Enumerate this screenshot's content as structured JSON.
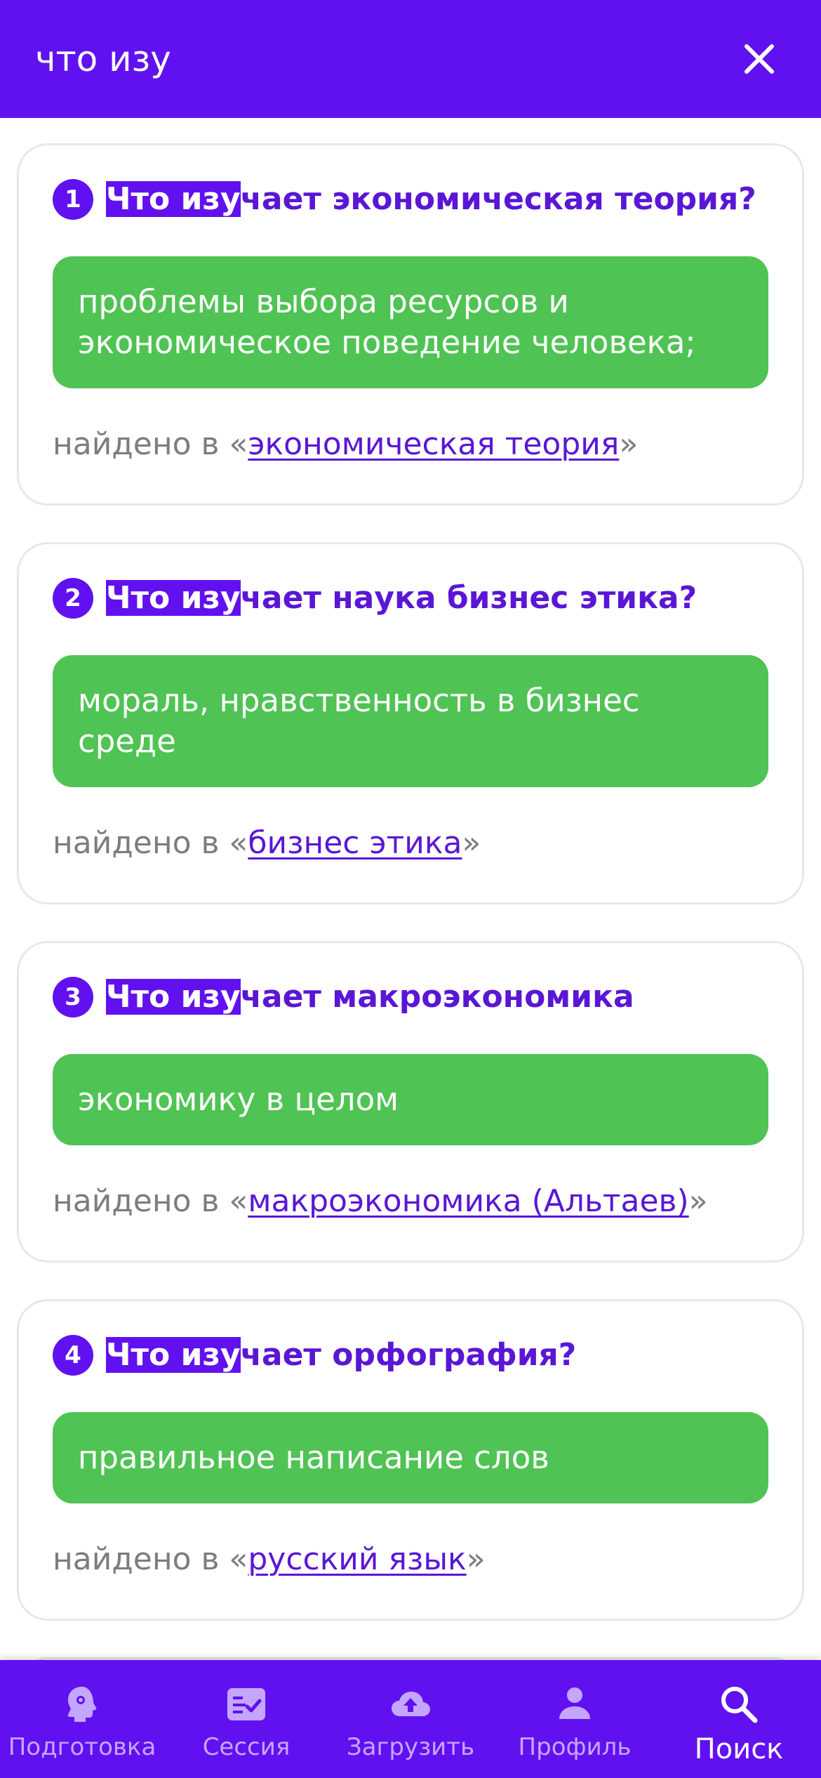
{
  "search": {
    "value": "что изу",
    "placeholder": ""
  },
  "results": [
    {
      "number": "1",
      "highlight": "Что изу",
      "rest": "чает экономическая теория?",
      "answer": "проблемы выбора ресурсов и экономическое поведение человека;",
      "found_prefix": "найдено в «",
      "found_link": "экономическая теория",
      "found_suffix": "»"
    },
    {
      "number": "2",
      "highlight": "Что изу",
      "rest": "чает наука бизнес этика?",
      "answer": "мораль, нравственность в бизнес среде",
      "found_prefix": "найдено в «",
      "found_link": "бизнес этика",
      "found_suffix": "»"
    },
    {
      "number": "3",
      "highlight": "Что изу",
      "rest": "чает макроэкономика",
      "answer": "экономику в целом",
      "found_prefix": "найдено в «",
      "found_link": "макроэкономика (Альтаев)",
      "found_suffix": "»"
    },
    {
      "number": "4",
      "highlight": "Что изу",
      "rest": "чает орфография?",
      "answer": "правильное написание слов",
      "found_prefix": "найдено в «",
      "found_link": "русский язык",
      "found_suffix": "»"
    }
  ],
  "tabs": [
    {
      "label": "Подготовка",
      "icon": "head-gear-icon"
    },
    {
      "label": "Сессия",
      "icon": "checklist-icon"
    },
    {
      "label": "Загрузить",
      "icon": "cloud-upload-icon"
    },
    {
      "label": "Профиль",
      "icon": "person-icon"
    },
    {
      "label": "Поиск",
      "icon": "search-icon",
      "active": true
    }
  ],
  "colors": {
    "primary": "#6111ef",
    "answer_green": "#4fc353",
    "muted_text": "#7c7c82",
    "inactive_tab": "#c5a6ff"
  }
}
